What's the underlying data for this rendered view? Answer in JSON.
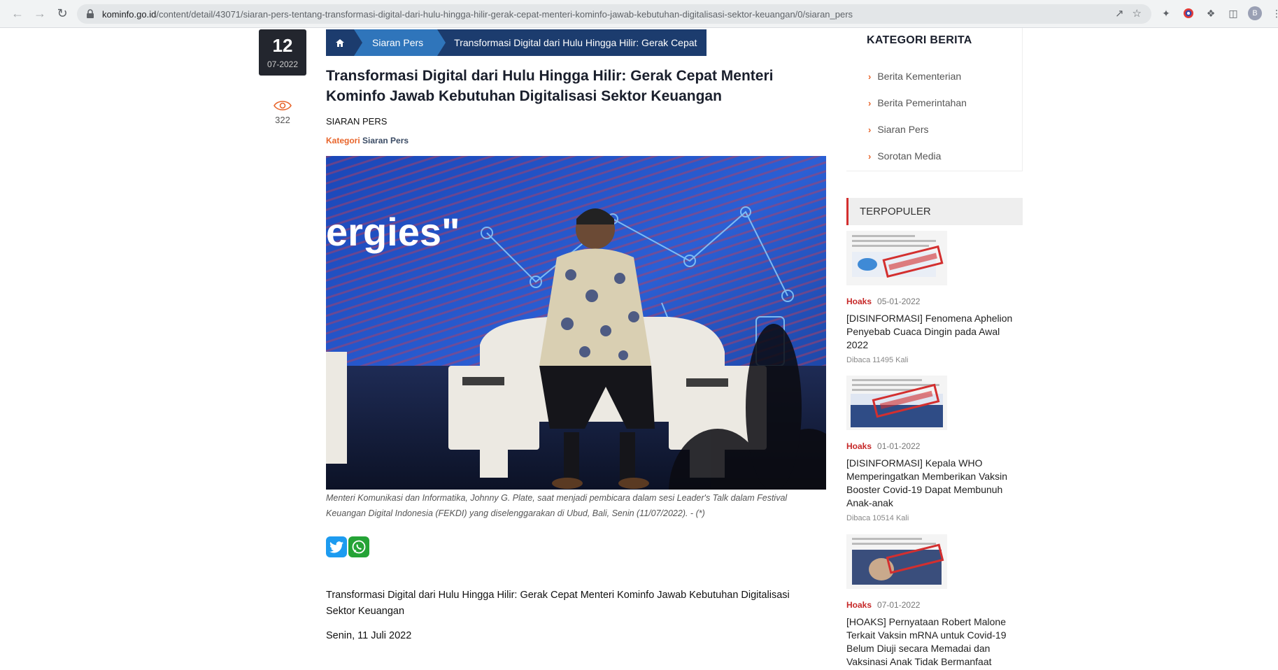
{
  "browser": {
    "url_domain": "kominfo.go.id",
    "url_path": "/content/detail/43071/siaran-pers-tentang-transformasi-digital-dari-hulu-hingga-hilir-gerak-cepat-menteri-kominfo-jawab-kebutuhan-digitalisasi-sektor-keuangan/0/siaran_pers",
    "profile_initial": "B"
  },
  "meta": {
    "day": "12",
    "month_year": "07-2022",
    "views": "322"
  },
  "breadcrumb": {
    "home_icon": "home-icon",
    "section": "Siaran Pers",
    "current": "Transformasi Digital dari Hulu Hingga Hilir: Gerak Cepat"
  },
  "article": {
    "title": "Transformasi Digital dari Hulu Hingga Hilir: Gerak Cepat Menteri Kominfo Jawab Kebutuhan Digitalisasi Sektor Keuangan",
    "type_label": "SIARAN PERS",
    "category_key": "Kategori",
    "category_value": "Siaran Pers",
    "photo_text": "ergies\"",
    "caption": "Menteri Komunikasi dan Informatika, Johnny G. Plate, saat menjadi pembicara dalam sesi Leader's Talk dalam Festival Keuangan Digital Indonesia (FEKDI) yang diselenggarakan di Ubud, Bali, Senin (11/07/2022). - (*)",
    "lead_title": "Transformasi Digital dari Hulu Hingga Hilir: Gerak Cepat Menteri Kominfo Jawab Kebutuhan Digitalisasi Sektor Keuangan",
    "lead_date": "Senin, 11 Juli 2022"
  },
  "sidebar": {
    "category_heading": "KATEGORI BERITA",
    "categories": [
      {
        "label": "Berita Kementerian"
      },
      {
        "label": "Berita Pemerintahan"
      },
      {
        "label": "Siaran Pers"
      },
      {
        "label": "Sorotan Media"
      }
    ],
    "popular_heading": "TERPOPULER",
    "popular": [
      {
        "tag": "Hoaks",
        "date": "05-01-2022",
        "title": "[DISINFORMASI] Fenomena Aphelion Penyebab Cuaca Dingin pada Awal 2022",
        "reads": "Dibaca 11495 Kali"
      },
      {
        "tag": "Hoaks",
        "date": "01-01-2022",
        "title": "[DISINFORMASI] Kepala WHO Memperingatkan Memberikan Vaksin Booster Covid-19 Dapat Membunuh Anak-anak",
        "reads": "Dibaca 10514 Kali"
      },
      {
        "tag": "Hoaks",
        "date": "07-01-2022",
        "title": "[HOAKS] Pernyataan Robert Malone Terkait Vaksin mRNA untuk Covid-19 Belum Diuji secara Memadai dan Vaksinasi Anak Tidak Bermanfaat",
        "reads": ""
      }
    ]
  },
  "colors": {
    "navy": "#1c3c6e",
    "blue": "#2f75bb",
    "orange": "#e8652b",
    "red": "#c62828"
  }
}
